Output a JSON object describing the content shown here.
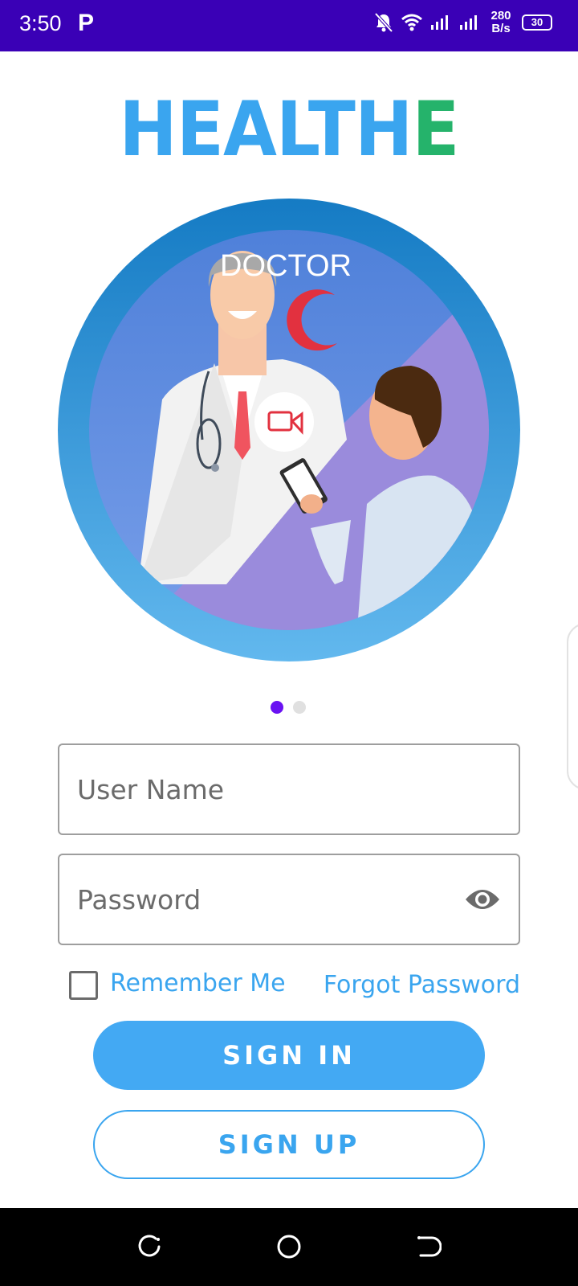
{
  "status_bar": {
    "time": "3:50",
    "app_indicator": "P",
    "net_speed_value": "280",
    "net_speed_unit": "B/s",
    "battery_level": "30",
    "icons": [
      "mute-notifications-icon",
      "wifi-icon",
      "signal-icon",
      "signal-icon",
      "battery-icon"
    ]
  },
  "logo": {
    "main": "HEALTH",
    "accent": "E",
    "colors": {
      "main": "#3aa5ef",
      "accent": "#25b36b"
    }
  },
  "illustration": {
    "caption": "DOCTOR",
    "icons": [
      "crescent-icon",
      "video-call-icon"
    ]
  },
  "pager": {
    "total": 2,
    "active_index": 0
  },
  "form": {
    "username": {
      "placeholder": "User Name",
      "value": ""
    },
    "password": {
      "placeholder": "Password",
      "value": ""
    },
    "remember_me": {
      "label": "Remember Me",
      "checked": false
    },
    "forgot_password": "Forgot Password"
  },
  "actions": {
    "sign_in": "SIGN IN",
    "sign_up": "SIGN UP"
  },
  "theme": {
    "status_bar": "#3a00b6",
    "accent": "#3aa5ef",
    "pager_active": "#6a12f2"
  },
  "nav_bar": {
    "icons": [
      "recent-apps-icon",
      "home-icon",
      "back-icon"
    ]
  }
}
